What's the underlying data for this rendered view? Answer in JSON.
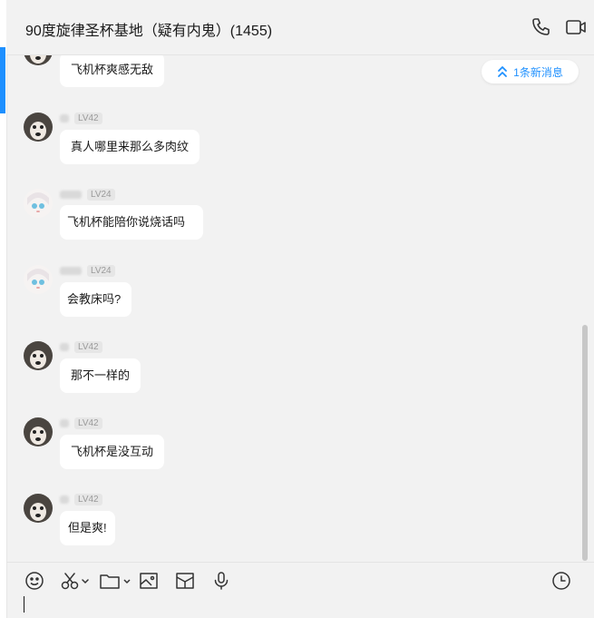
{
  "chat": {
    "title": "90度旋律圣杯基地（疑有内鬼）(1455)",
    "new_message_label": "1条新消息"
  },
  "messages": [
    {
      "level": "",
      "text": "飞机杯爽感无敌",
      "avatar": "husky-avatar"
    },
    {
      "level": "LV42",
      "text": "真人哪里来那么多肉纹",
      "avatar": "husky-avatar"
    },
    {
      "level": "LV24",
      "text": "飞机杯能陪你说烧话吗",
      "avatar": "anime-avatar"
    },
    {
      "level": "LV24",
      "text": "会教床吗?",
      "avatar": "anime-avatar"
    },
    {
      "level": "LV42",
      "text": "那不一样的",
      "avatar": "husky-avatar"
    },
    {
      "level": "LV42",
      "text": "飞机杯是没互动",
      "avatar": "husky-avatar"
    },
    {
      "level": "LV42",
      "text": "但是爽!",
      "avatar": "husky-avatar"
    }
  ],
  "toolbar": {
    "icons": [
      "emoji-icon",
      "scissors-icon",
      "folder-icon",
      "image-icon",
      "red-packet-icon",
      "microphone-icon",
      "history-clock-icon"
    ]
  },
  "colors": {
    "accent": "#1e90ff",
    "background": "#f2f2f2",
    "bubble": "#ffffff"
  }
}
